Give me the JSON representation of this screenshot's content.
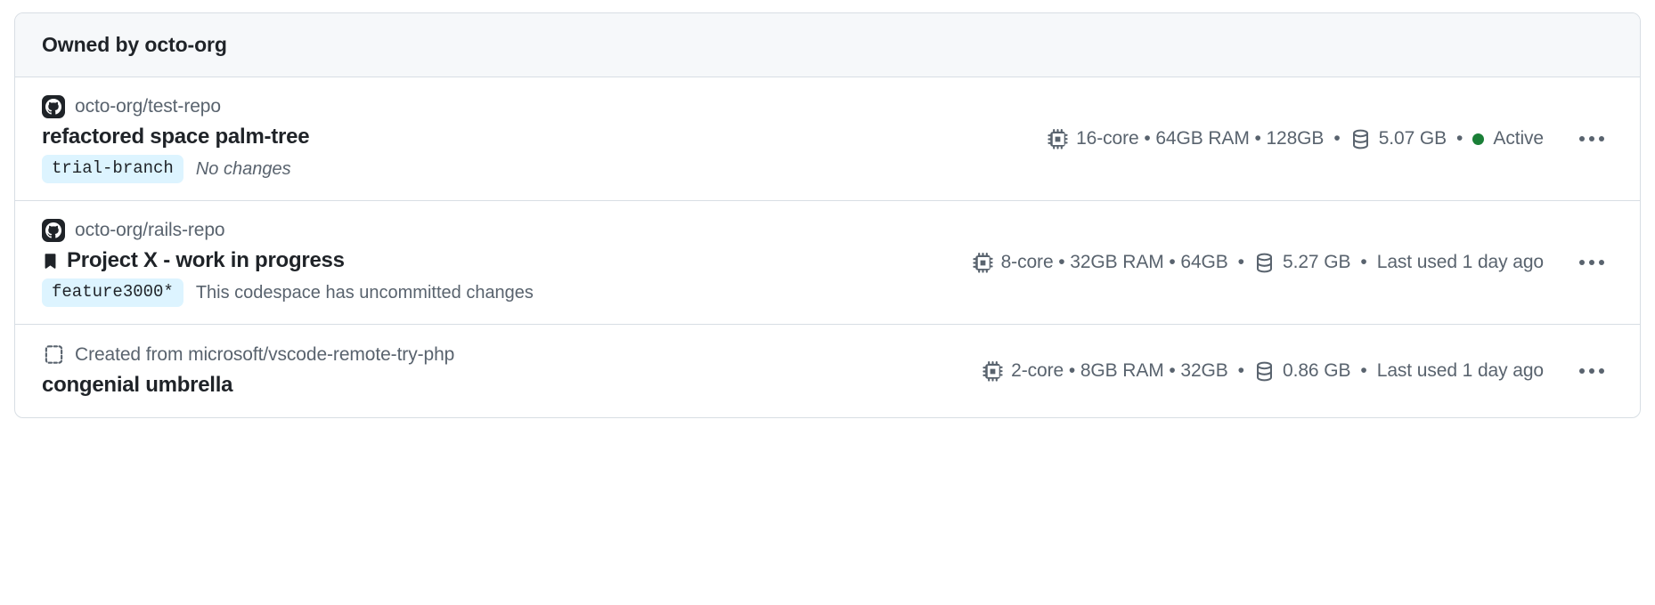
{
  "header": {
    "title": "Owned by octo-org"
  },
  "colors": {
    "accent_badge_bg": "#ddf4ff",
    "status_active": "#1a7f37",
    "muted_text": "#59636e",
    "primary_text": "#1f2328",
    "card_border": "#d8dee4",
    "header_bg": "#f6f8fa"
  },
  "separator": "•",
  "codespaces": [
    {
      "repo_icon": "github-mark-icon",
      "repo": "octo-org/test-repo",
      "pinned": false,
      "title": "refactored space palm-tree",
      "branch": "trial-branch",
      "changes": "No changes",
      "changes_italic": true,
      "machine_icon": "cpu-icon",
      "machine": "16-core • 64GB RAM • 128GB",
      "storage_icon": "database-icon",
      "storage": "5.07 GB",
      "status": "Active",
      "status_color": "#1a7f37",
      "has_status_dot": true,
      "menu_icon": "kebab-menu-icon"
    },
    {
      "repo_icon": "github-mark-icon",
      "repo": "octo-org/rails-repo",
      "pinned": true,
      "title": "Project X - work in progress",
      "branch": "feature3000*",
      "changes": "This codespace has uncommitted changes",
      "changes_italic": false,
      "machine_icon": "cpu-icon",
      "machine": "8-core • 32GB RAM • 64GB",
      "storage_icon": "database-icon",
      "storage": "5.27 GB",
      "status": "Last used 1 day ago",
      "has_status_dot": false,
      "menu_icon": "kebab-menu-icon"
    },
    {
      "repo_icon": "repo-template-icon",
      "repo": "Created from microsoft/vscode-remote-try-php",
      "pinned": false,
      "title": "congenial umbrella",
      "branch": null,
      "changes": null,
      "changes_italic": false,
      "machine_icon": "cpu-icon",
      "machine": "2-core • 8GB RAM • 32GB",
      "storage_icon": "database-icon",
      "storage": "0.86 GB",
      "status": "Last used 1 day ago",
      "has_status_dot": false,
      "menu_icon": "kebab-menu-icon"
    }
  ]
}
